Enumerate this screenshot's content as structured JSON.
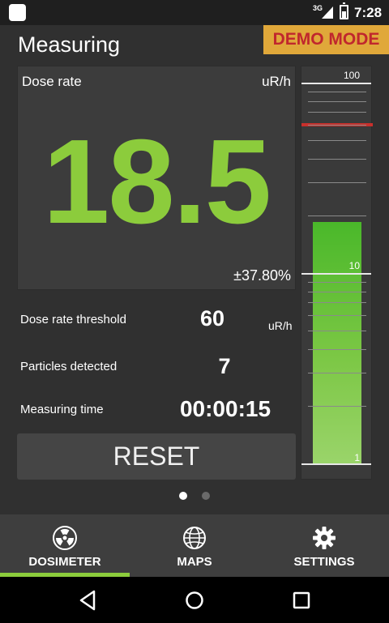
{
  "status_bar": {
    "network": "3G",
    "time": "7:28"
  },
  "header": {
    "title": "Measuring",
    "demo_badge": "DEMO MODE"
  },
  "dose": {
    "label": "Dose rate",
    "unit": "uR/h",
    "value": "18.5",
    "error": "±37.80%"
  },
  "stats": [
    {
      "label": "Dose rate threshold",
      "value": "60",
      "unit": "uR/h"
    },
    {
      "label": "Particles detected",
      "value": "7"
    },
    {
      "label": "Measuring time",
      "value": "00:00:15"
    }
  ],
  "reset_label": "RESET",
  "meter": {
    "labels": {
      "top": "100",
      "mid": "10",
      "bottom": "1"
    },
    "scale": "log",
    "range": [
      1,
      100
    ],
    "level": 18.5,
    "threshold": 60,
    "bar_color": "#5cc232",
    "threshold_color": "#c9302c"
  },
  "pager": {
    "count": 2,
    "active_index": 0
  },
  "tabs": [
    {
      "label": "DOSIMETER",
      "icon": "radiation-icon",
      "active": true
    },
    {
      "label": "MAPS",
      "icon": "globe-icon",
      "active": false
    },
    {
      "label": "SETTINGS",
      "icon": "gear-icon",
      "active": false
    }
  ],
  "colors": {
    "accent": "#8ccc3c",
    "demo_bg": "#e0a83a",
    "demo_text": "#c0272d"
  }
}
